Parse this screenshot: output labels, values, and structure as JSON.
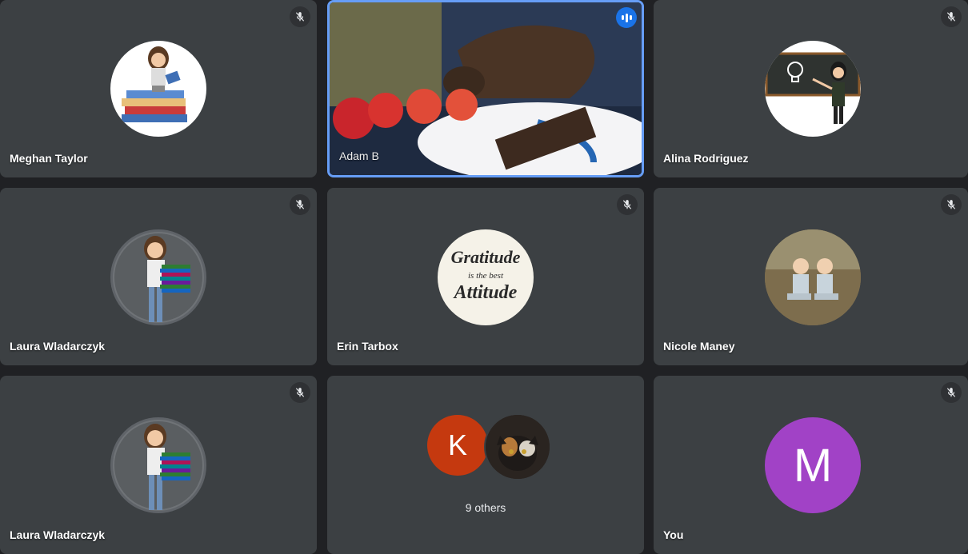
{
  "participants": [
    {
      "name": "Meghan Taylor",
      "muted": true,
      "avatar_icon": "bitmoji-reading-books-icon"
    },
    {
      "name": "Adam B",
      "speaking": true,
      "video": "tortoise-eating-strawberries"
    },
    {
      "name": "Alina Rodriguez",
      "muted": true,
      "avatar_icon": "bitmoji-chalkboard-icon"
    },
    {
      "name": "Laura Wladarczyk",
      "muted": true,
      "avatar_icon": "bitmoji-holding-books-icon"
    },
    {
      "name": "Erin Tarbox",
      "muted": true,
      "avatar_text_line1": "Gratitude",
      "avatar_text_line2": "is the best",
      "avatar_text_line3": "Attitude"
    },
    {
      "name": "Nicole Maney",
      "muted": true,
      "avatar_icon": "two-children-photo-icon"
    },
    {
      "name": "Laura Wladarczyk",
      "muted": true,
      "avatar_icon": "bitmoji-holding-books-icon"
    },
    {
      "others_label": "9 others",
      "avatar_letter": "K",
      "avatar_color": "#c5390f",
      "second_avatar_icon": "cat-photo-icon"
    },
    {
      "name": "You",
      "muted": true,
      "avatar_letter": "M",
      "avatar_color": "#a142c6"
    }
  ],
  "colors": {
    "background": "#202124",
    "tile": "#3c4043",
    "active_border": "#669df6",
    "speaking_badge": "#1a73e8"
  }
}
